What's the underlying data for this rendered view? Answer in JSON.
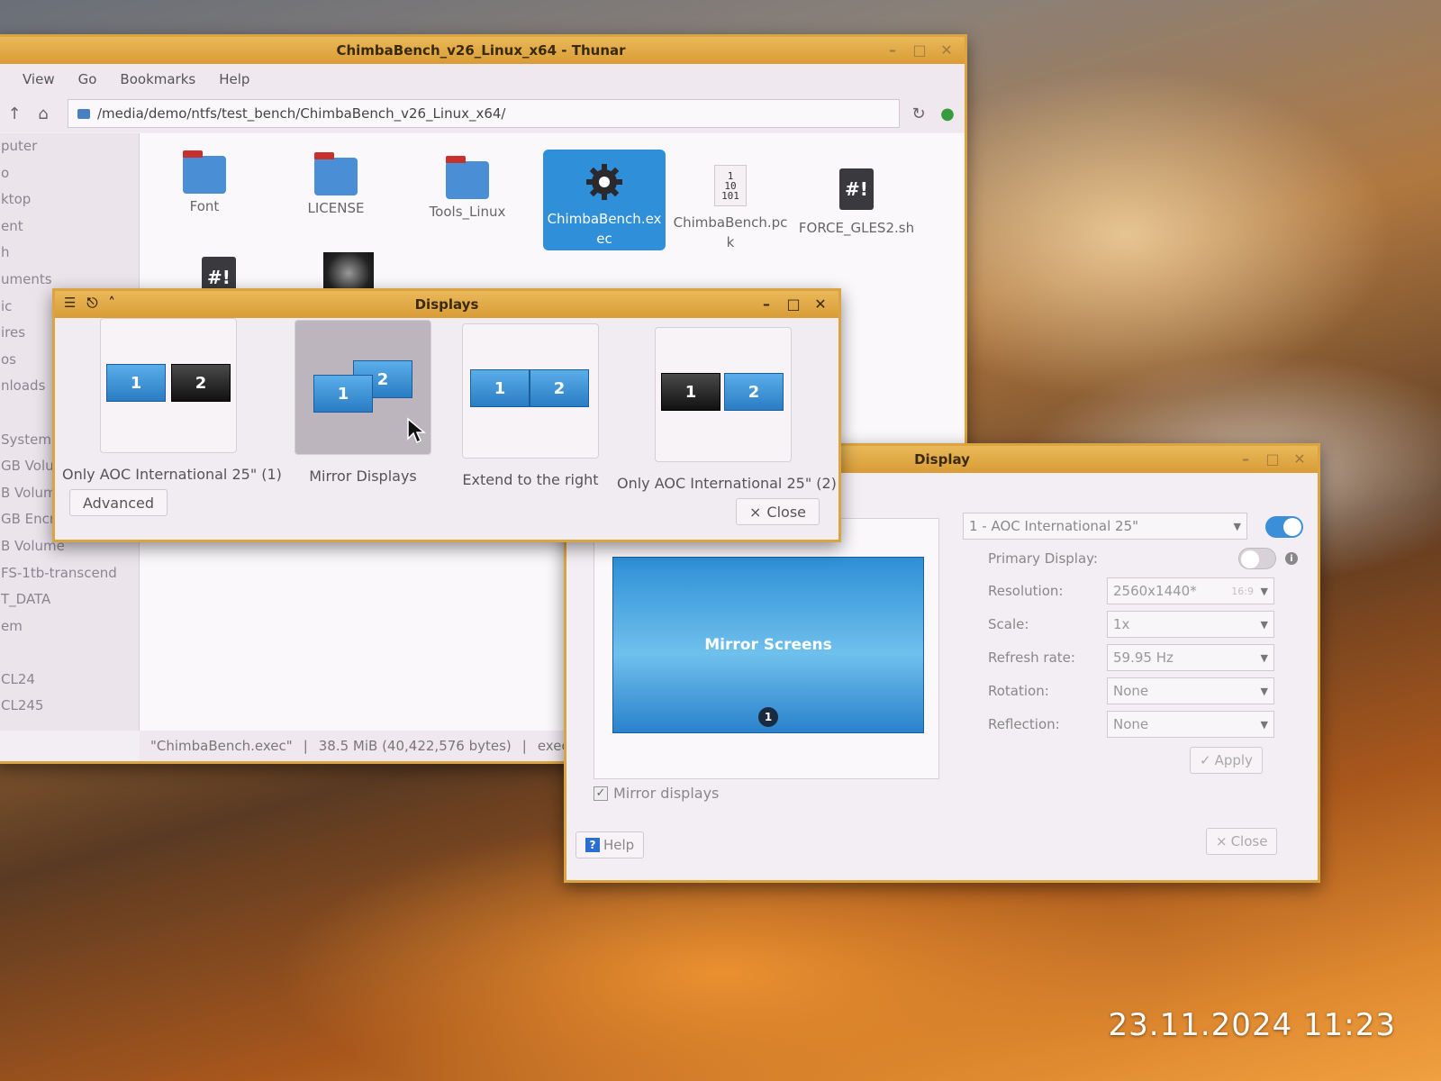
{
  "thunar": {
    "title": "ChimbaBench_v26_Linux_x64 - Thunar",
    "menu": [
      "View",
      "Go",
      "Bookmarks",
      "Help"
    ],
    "path": "/media/demo/ntfs/test_bench/ChimbaBench_v26_Linux_x64/",
    "sidebar": [
      "puter",
      "o",
      "ktop",
      "ent",
      "h",
      "uments",
      "ic",
      "ires",
      "os",
      "nloads",
      "",
      "System",
      "GB Volu",
      "B Volum",
      "GB Encrypted",
      "B Volume",
      "FS-1tb-transcend",
      "T_DATA",
      "em",
      "",
      "CL24",
      "CL245"
    ],
    "files": [
      {
        "name": "Font",
        "icon": "folder-icon"
      },
      {
        "name": "LICENSE",
        "icon": "folder-icon"
      },
      {
        "name": "Tools_Linux",
        "icon": "folder-icon"
      },
      {
        "name": "ChimbaBench.exec",
        "icon": "gear-icon"
      },
      {
        "name": "ChimbaBench.pck",
        "icon": "binary-file-icon"
      },
      {
        "name": "FORCE_GLES2.sh",
        "icon": "script-icon"
      }
    ],
    "file_glyphs": {
      "binary": "1\n10\n101",
      "script": "#!"
    },
    "status": {
      "name": "\"ChimbaBench.exec\"",
      "size": "38.5 MiB (40,422,576 bytes)",
      "type": "exec"
    }
  },
  "displays": {
    "title": "Displays",
    "options": [
      {
        "label": "Only AOC International 25\" (1)",
        "m1": "1",
        "m2": "2"
      },
      {
        "label": "Mirror Displays",
        "m1": "1",
        "m2": "2"
      },
      {
        "label": "Extend to the right",
        "m1": "1",
        "m2": "2"
      },
      {
        "label": "Only AOC International 25\" (2)",
        "m1": "1",
        "m2": "2"
      }
    ],
    "advanced_label": "Advanced",
    "close_label": "Close"
  },
  "display": {
    "title": "Display",
    "preview_label": "Mirror Screens",
    "preview_badge": "1",
    "monitor_select": "1 - AOC International 25\"",
    "primary_label": "Primary Display:",
    "fields": [
      {
        "label": "Resolution:",
        "value": "2560x1440*",
        "hint": "16:9"
      },
      {
        "label": "Scale:",
        "value": "1x"
      },
      {
        "label": "Refresh rate:",
        "value": "59.95 Hz"
      },
      {
        "label": "Rotation:",
        "value": "None"
      },
      {
        "label": "Reflection:",
        "value": "None"
      }
    ],
    "apply_label": "Apply",
    "mirror_label": "Mirror displays",
    "help_label": "Help",
    "close_label": "Close"
  },
  "timestamp": "23.11.2024 11:23",
  "colors": {
    "accent": "#2f8fd8",
    "frame": "#d9a441"
  }
}
